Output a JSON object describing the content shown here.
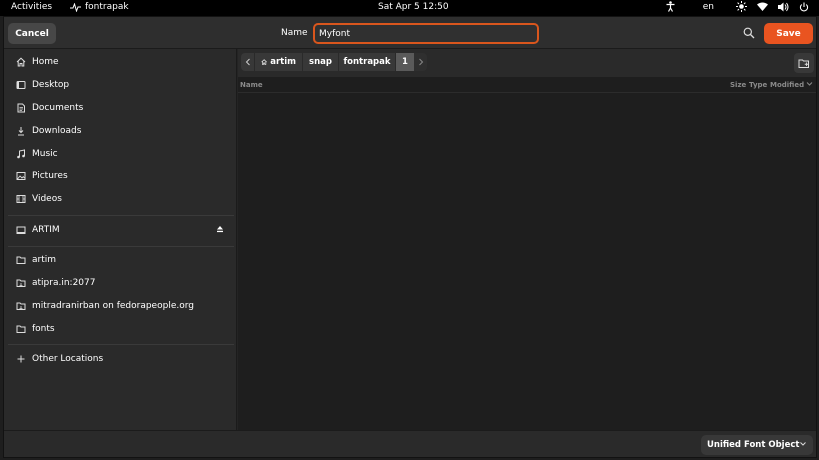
{
  "topbar": {
    "activities": "Activities",
    "app_name": "fontrapak",
    "clock": "Sat Apr 5  12:50",
    "language": "en"
  },
  "header": {
    "cancel_label": "Cancel",
    "name_label": "Name",
    "name_value": "Myfont",
    "save_label": "Save"
  },
  "sidebar": {
    "places": [
      {
        "label": "Home",
        "icon": "home-icon"
      },
      {
        "label": "Desktop",
        "icon": "desktop-icon"
      },
      {
        "label": "Documents",
        "icon": "documents-icon"
      },
      {
        "label": "Downloads",
        "icon": "downloads-icon"
      },
      {
        "label": "Music",
        "icon": "music-icon"
      },
      {
        "label": "Pictures",
        "icon": "pictures-icon"
      },
      {
        "label": "Videos",
        "icon": "videos-icon"
      }
    ],
    "devices": [
      {
        "label": "ARTIM",
        "icon": "drive-icon"
      }
    ],
    "bookmarks": [
      {
        "label": "artim",
        "icon": "folder-icon"
      },
      {
        "label": "atipra.in:2077",
        "icon": "network-folder-icon"
      },
      {
        "label": "mitradranirban on fedorapeople.org",
        "icon": "network-folder-icon"
      },
      {
        "label": "fonts",
        "icon": "folder-icon"
      }
    ],
    "other_locations": "Other Locations"
  },
  "pathbar": {
    "crumbs": [
      "artim",
      "snap",
      "fontrapak",
      "1"
    ]
  },
  "columns": {
    "name": "Name",
    "size": "Size",
    "type": "Type",
    "modified": "Modified"
  },
  "footer": {
    "filter_value": "Unified Font Object"
  },
  "colors": {
    "accent": "#e95420",
    "background": "#242424",
    "sidebar": "#2a2a2a"
  }
}
